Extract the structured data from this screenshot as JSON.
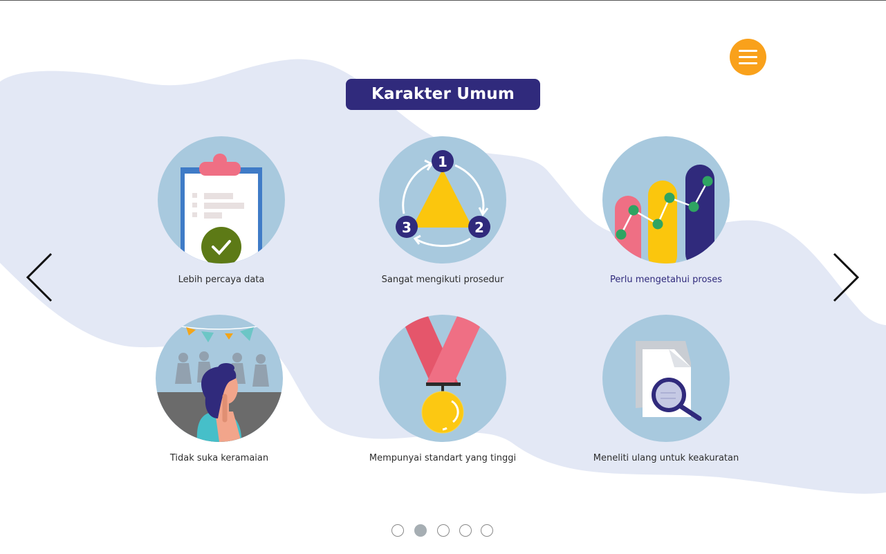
{
  "header": {
    "title": "Karakter Umum"
  },
  "menu": {
    "icon": "hamburger-menu-icon"
  },
  "navigation": {
    "prev_icon": "chevron-left-icon",
    "next_icon": "chevron-right-icon"
  },
  "cards": [
    {
      "label": "Lebih percaya data",
      "icon": "clipboard-check-icon"
    },
    {
      "label": "Sangat mengikuti prosedur",
      "icon": "cycle-triangle-icon"
    },
    {
      "label": "Perlu mengetahui proses",
      "icon": "bar-chart-icon"
    },
    {
      "label": "Tidak suka keramaian",
      "icon": "introvert-person-icon"
    },
    {
      "label": "Mempunyai standart yang tinggi",
      "icon": "medal-icon"
    },
    {
      "label": "Meneliti ulang untuk keakuratan",
      "icon": "document-magnifier-icon"
    }
  ],
  "cycle_numbers": [
    "1",
    "2",
    "3"
  ],
  "pagination": {
    "count": 5,
    "active_index": 1
  },
  "colors": {
    "title_bg": "#302a7c",
    "menu_bg": "#f9a11b",
    "circle_bg": "#a8c9de",
    "blob_bg": "#e3e8f5"
  }
}
